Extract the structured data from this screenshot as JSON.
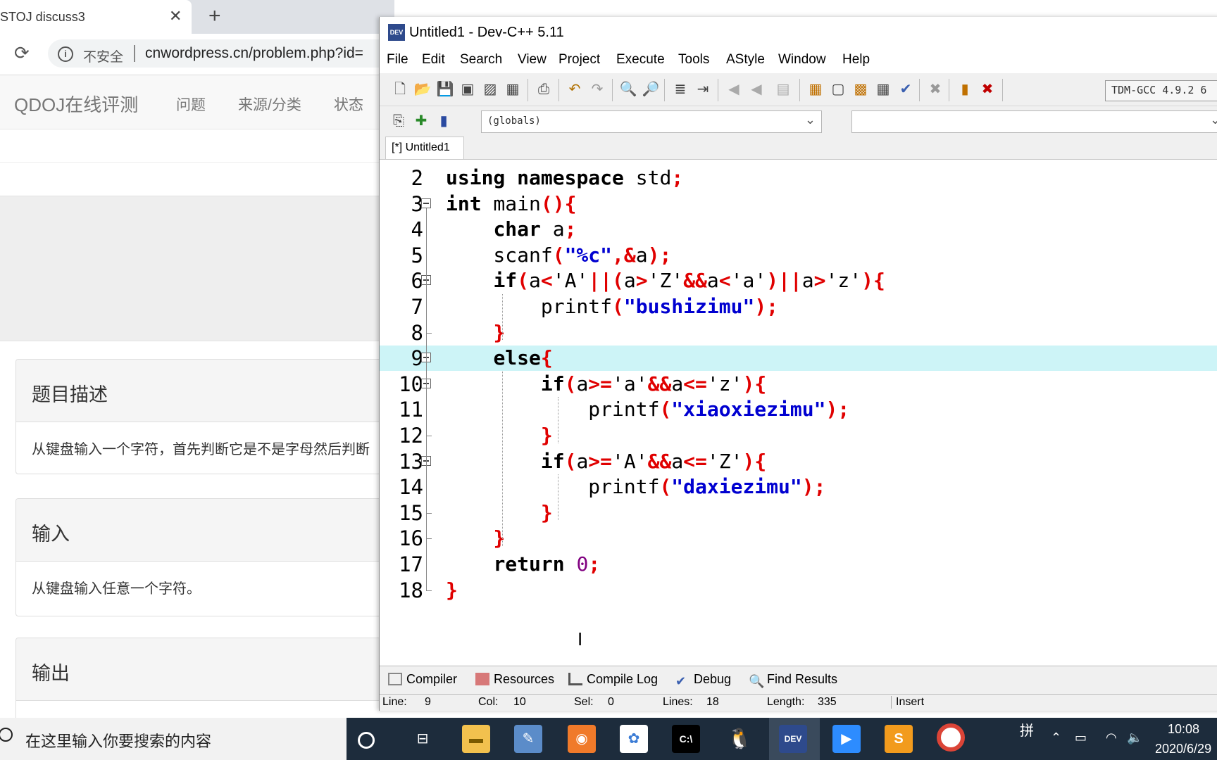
{
  "browser": {
    "tab_title": "STOJ discuss3",
    "insecure_label": "不安全",
    "url": "cnwordpress.cn/problem.php?id=",
    "site_brand": "QDOJ在线评测",
    "nav": [
      "问题",
      "来源/分类",
      "状态"
    ],
    "panels": [
      {
        "title": "题目描述",
        "body": "从键盘输入一个字符，首先判断它是不是字母然后判断"
      },
      {
        "title": "输入",
        "body": "从键盘输入任意一个字符。"
      },
      {
        "title": "输出",
        "body": ""
      }
    ]
  },
  "devcpp": {
    "window_title": "Untitled1 - Dev-C++ 5.11",
    "menu": [
      "File",
      "Edit",
      "Search",
      "View",
      "Project",
      "Execute",
      "Tools",
      "AStyle",
      "Window",
      "Help"
    ],
    "compiler": "TDM-GCC 4.9.2 6",
    "scope": "(globals)",
    "file_tab": "[*] Untitled1",
    "line_numbers": [
      "2",
      "3",
      "4",
      "5",
      "6",
      "7",
      "8",
      "9",
      "10",
      "11",
      "12",
      "13",
      "14",
      "15",
      "16",
      "17",
      "18"
    ],
    "code_lines": [
      "using namespace std;",
      "int main(){",
      "    char a;",
      "    scanf(\"%c\",&a);",
      "    if(a<'A'||(a>'Z'&&a<'a')||a>'z'){",
      "        printf(\"bushizimu\");",
      "    }",
      "    else{",
      "        if(a>='a'&&a<='z'){",
      "            printf(\"xiaoxiezimu\");",
      "        }",
      "        if(a>='A'&&a<='Z'){",
      "            printf(\"daxiezimu\");",
      "        }",
      "    }",
      "    return 0;",
      "}"
    ],
    "bottom_tabs": [
      "Compiler",
      "Resources",
      "Compile Log",
      "Debug",
      "Find Results"
    ],
    "status": {
      "line_label": "Line:",
      "line": "9",
      "col_label": "Col:",
      "col": "10",
      "sel_label": "Sel:",
      "sel": "0",
      "lines_label": "Lines:",
      "lines": "18",
      "length_label": "Length:",
      "length": "335",
      "mode": "Insert"
    }
  },
  "taskbar": {
    "search_placeholder": "在这里输入你要搜索的内容",
    "ime": "拼",
    "time": "10:08",
    "date": "2020/6/29"
  }
}
